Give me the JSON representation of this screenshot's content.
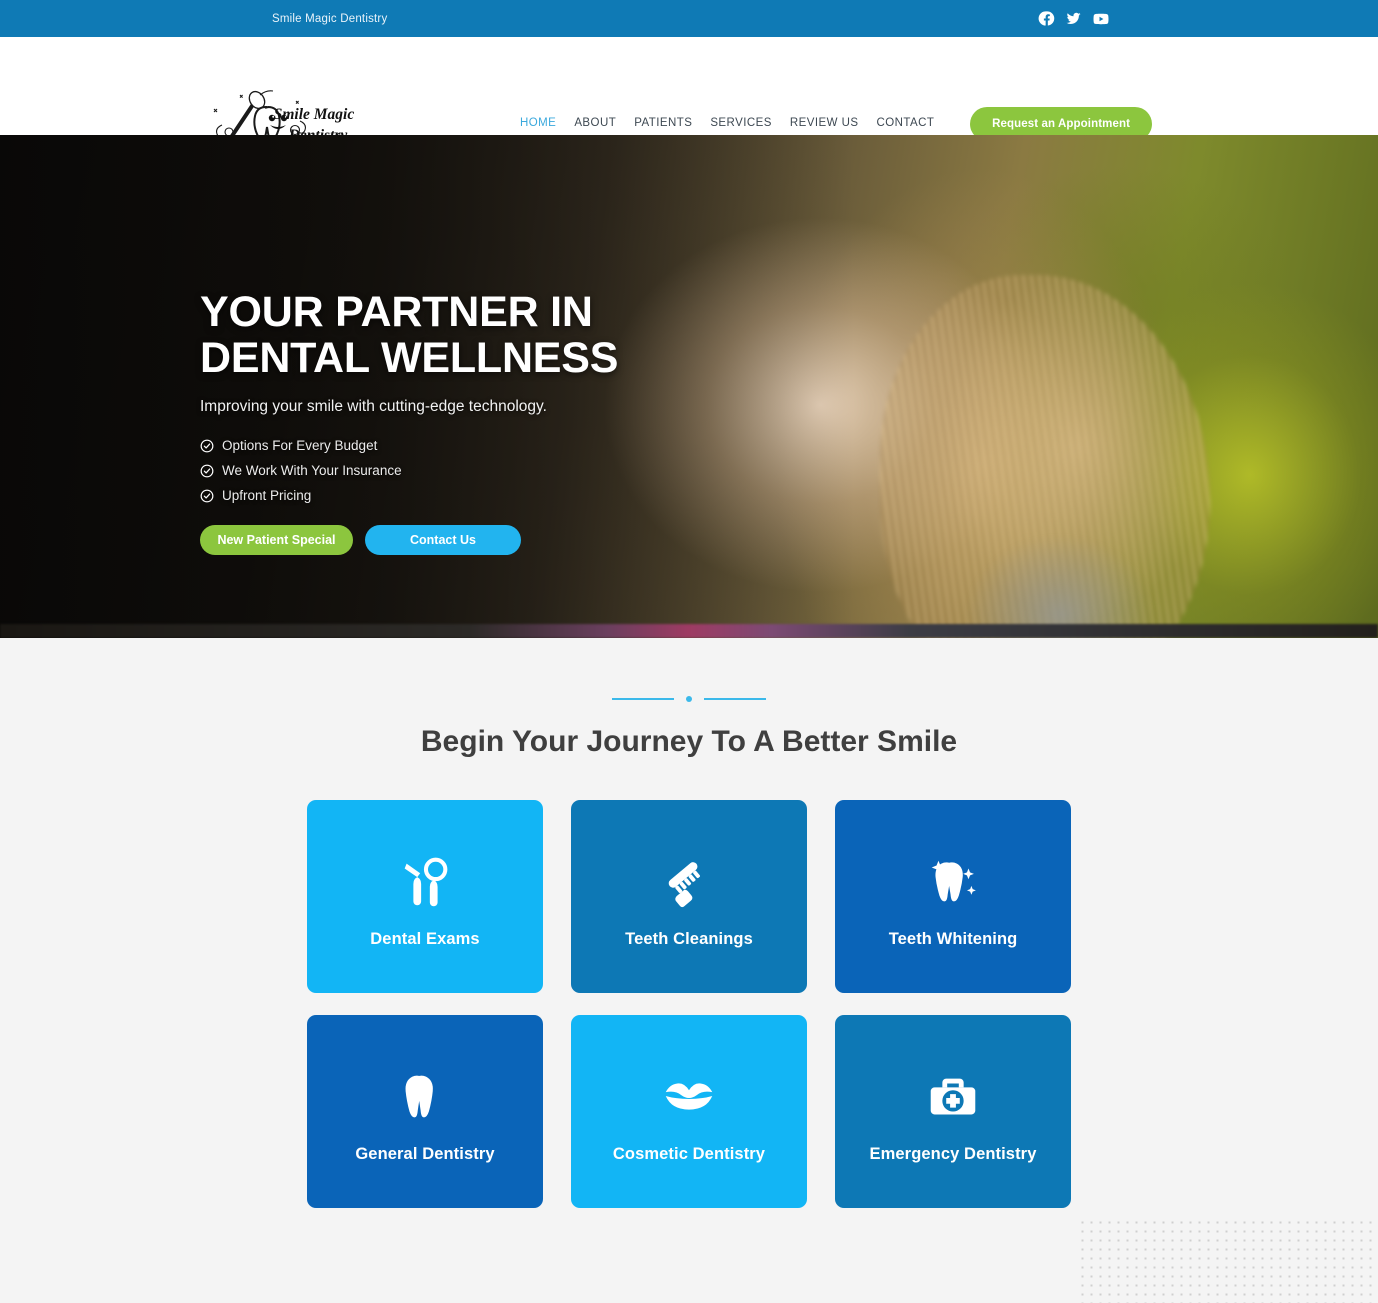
{
  "topbar": {
    "title": "Smile Magic Dentistry",
    "social": [
      {
        "name": "facebook-icon",
        "label": "Facebook"
      },
      {
        "name": "twitter-icon",
        "label": "Twitter"
      },
      {
        "name": "youtube-icon",
        "label": "YouTube"
      }
    ]
  },
  "header": {
    "logo_text_line1": "Smile Magic",
    "logo_text_line2": "Dentistry",
    "nav": [
      {
        "label": "HOME",
        "active": true
      },
      {
        "label": "ABOUT",
        "active": false
      },
      {
        "label": "PATIENTS",
        "active": false
      },
      {
        "label": "SERVICES",
        "active": false
      },
      {
        "label": "REVIEW US",
        "active": false
      },
      {
        "label": "CONTACT",
        "active": false
      }
    ],
    "cta_label": "Request an Appointment",
    "cta_color": "#8cc63e"
  },
  "hero": {
    "heading_line1": "YOUR PARTNER IN",
    "heading_line2": "DENTAL WELLNESS",
    "subheading": "Improving your smile with cutting-edge technology.",
    "features": [
      "Options For Every Budget",
      "We Work With Your Insurance",
      "Upfront Pricing"
    ],
    "primary_button": "New Patient Special",
    "secondary_button": "Contact Us",
    "primary_color": "#8cc63e",
    "secondary_color": "#22b4ef"
  },
  "services": {
    "title": "Begin Your Journey To A Better Smile",
    "cards": [
      {
        "label": "Dental Exams",
        "icon": "dental-tools-icon",
        "color": "#12b5f5"
      },
      {
        "label": "Teeth Cleanings",
        "icon": "toothbrush-icon",
        "color": "#0d78b5"
      },
      {
        "label": "Teeth Whitening",
        "icon": "sparkling-tooth-icon",
        "color": "#0a64b8"
      },
      {
        "label": "General Dentistry",
        "icon": "tooth-icon",
        "color": "#0a64b8"
      },
      {
        "label": "Cosmetic Dentistry",
        "icon": "lips-icon",
        "color": "#12b5f5"
      },
      {
        "label": "Emergency Dentistry",
        "icon": "first-aid-kit-icon",
        "color": "#0d78b5"
      }
    ]
  }
}
